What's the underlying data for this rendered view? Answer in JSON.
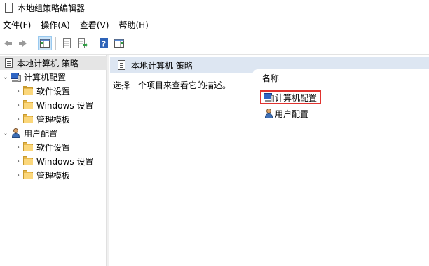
{
  "window": {
    "title": "本地组策略编辑器"
  },
  "menu": [
    {
      "label": "文件(F)"
    },
    {
      "label": "操作(A)"
    },
    {
      "label": "查看(V)"
    },
    {
      "label": "帮助(H)"
    }
  ],
  "toolbar": {
    "buttons": [
      "back-icon",
      "forward-icon",
      "show-hide-console-tree-icon",
      "properties-icon",
      "export-list-icon",
      "help-icon",
      "show-hide-action-pane-icon"
    ]
  },
  "tree": {
    "root": "本地计算机 策略",
    "computer_config": "计算机配置",
    "user_config": "用户配置",
    "computer_children": [
      "软件设置",
      "Windows 设置",
      "管理模板"
    ],
    "user_children": [
      "软件设置",
      "Windows 设置",
      "管理模板"
    ]
  },
  "main": {
    "header_title": "本地计算机 策略",
    "description": "选择一个项目来查看它的描述。",
    "column_name": "名称",
    "items": [
      "计算机配置",
      "用户配置"
    ]
  },
  "colors": {
    "highlight_border": "#e0332f",
    "header_bg": "#dde6f2",
    "selected_bg": "#e5e5e5"
  }
}
